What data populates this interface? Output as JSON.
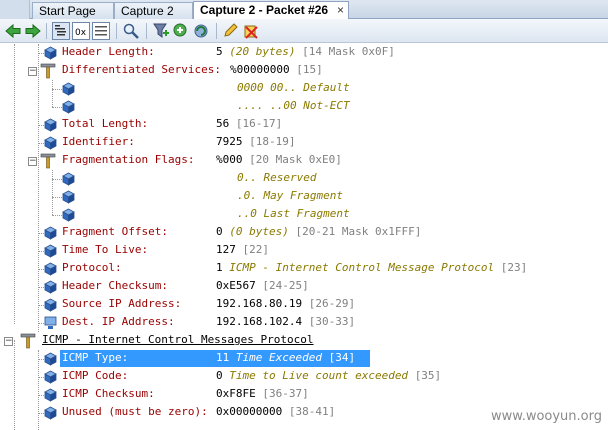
{
  "tabs": [
    {
      "label": "Start Page",
      "active": false
    },
    {
      "label": "Capture 2",
      "active": false
    },
    {
      "label": "Capture 2 - Packet #26",
      "active": true
    }
  ],
  "tab_close_glyph": "×",
  "toolbar": {
    "icons": [
      "back-arrow-icon",
      "forward-arrow-icon",
      "decode-view-icon",
      "hex-view-icon",
      "packet-view-icon",
      "find-icon",
      "add-filter-icon",
      "add-rule-icon",
      "refresh-icon",
      "edit-icon",
      "clear-icon"
    ]
  },
  "tree": {
    "rows": [
      {
        "label": "Header Length:",
        "value": "5",
        "desc": "(20 bytes)",
        "offset": "[14 Mask 0x0F]"
      },
      {
        "label": "Differentiated Services:",
        "value": "%00000000",
        "desc": "",
        "offset": "[15]",
        "expander": "−"
      },
      {
        "label": "",
        "value": "",
        "desc": "0000 00.. Default",
        "offset": ""
      },
      {
        "label": "",
        "value": "",
        "desc": ".... ..00 Not-ECT",
        "offset": ""
      },
      {
        "label": "Total Length:",
        "value": "56",
        "desc": "",
        "offset": "[16-17]"
      },
      {
        "label": "Identifier:",
        "value": "7925",
        "desc": "",
        "offset": "[18-19]"
      },
      {
        "label": "Fragmentation Flags:",
        "value": "%000",
        "desc": "",
        "offset": "[20 Mask 0xE0]",
        "expander": "−"
      },
      {
        "label": "",
        "value": "",
        "desc": "0.. Reserved",
        "offset": ""
      },
      {
        "label": "",
        "value": "",
        "desc": ".0. May Fragment",
        "offset": ""
      },
      {
        "label": "",
        "value": "",
        "desc": "..0 Last Fragment",
        "offset": ""
      },
      {
        "label": "Fragment Offset:",
        "value": "0",
        "desc": "(0 bytes)",
        "offset": "[20-21 Mask 0x1FFF]"
      },
      {
        "label": "Time To Live:",
        "value": "127",
        "desc": "",
        "offset": "[22]"
      },
      {
        "label": "Protocol:",
        "value": "1",
        "desc": "ICMP - Internet Control Message Protocol",
        "offset": "[23]"
      },
      {
        "label": "Header Checksum:",
        "value": "0xE567",
        "desc": "",
        "offset": "[24-25]"
      },
      {
        "label": "Source IP Address:",
        "value": "192.168.80.19",
        "desc": "",
        "offset": "[26-29]"
      },
      {
        "label": "Dest. IP Address:",
        "value": "192.168.102.4",
        "desc": "",
        "offset": "[30-33]"
      },
      {
        "label": "ICMP - Internet Control Messages Protocol",
        "value": "",
        "desc": "",
        "offset": "",
        "expander": "−"
      },
      {
        "label": "ICMP Type:",
        "value": "11",
        "desc": "Time Exceeded",
        "offset": "[34]"
      },
      {
        "label": "ICMP Code:",
        "value": "0",
        "desc": "Time to Live count exceeded",
        "offset": "[35]"
      },
      {
        "label": "ICMP Checksum:",
        "value": "0xF8FE",
        "desc": "",
        "offset": "[36-37]"
      },
      {
        "label": "Unused (must be zero):",
        "value": "0x00000000",
        "desc": "",
        "offset": "[38-41]"
      }
    ]
  },
  "watermark": "www.wooyun.org",
  "colors": {
    "field_label": "#990000",
    "description": "#8a7a00",
    "offset": "#808080",
    "selection": "#3399ff"
  }
}
